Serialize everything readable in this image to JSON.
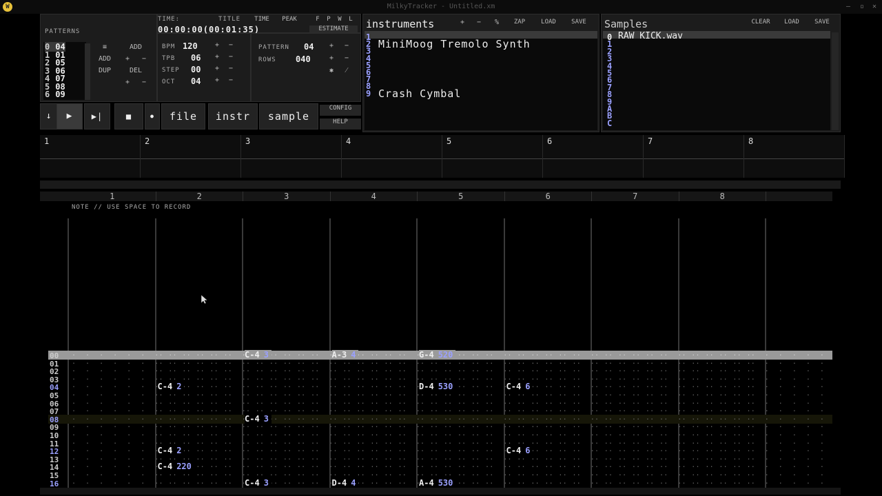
{
  "window": {
    "title": "MilkyTracker - Untitled.xm",
    "app_icon": "W",
    "min": "—",
    "max": "▫",
    "close": "✕"
  },
  "patterns_panel": {
    "title": "PATTERNS",
    "list": [
      {
        "idx": "0",
        "val": "04"
      },
      {
        "idx": "1",
        "val": "01"
      },
      {
        "idx": "2",
        "val": "05"
      },
      {
        "idx": "3",
        "val": "06"
      },
      {
        "idx": "4",
        "val": "07"
      },
      {
        "idx": "5",
        "val": "08"
      },
      {
        "idx": "6",
        "val": "09"
      }
    ],
    "menu_icon": "≡",
    "add": "ADD",
    "plus": "+",
    "minus": "−",
    "add2": "ADD",
    "dup": "DUP",
    "del": "DEL"
  },
  "song_params": {
    "bpm": {
      "label": "BPM",
      "value": "120"
    },
    "tpb": {
      "label": "TPB",
      "value": "06"
    },
    "step": {
      "label": "STEP",
      "value": "00"
    },
    "oct": {
      "label": "OCT",
      "value": "04"
    }
  },
  "time_panel": {
    "time_label": "TIME:",
    "time_value": "00:00:00(00:01:35)",
    "title_label": "TITLE",
    "time_btn": "TIME",
    "peak_btn": "PEAK",
    "flags": [
      "F",
      "P",
      "W",
      "L"
    ],
    "estimate": "ESTIMATE"
  },
  "pattern_params": {
    "pattern": {
      "label": "PATTERN",
      "value": "04"
    },
    "rows": {
      "label": "ROWS",
      "value": "040"
    },
    "star": "✱",
    "slash": "⁄"
  },
  "transport": {
    "down_icon": "↓",
    "play_icon": "▶",
    "play_pattern_icon": "▶|",
    "stop_icon": "■",
    "record_icon": "●",
    "file": "file",
    "instr": "instr",
    "sample": "sample",
    "config": "CONFIG",
    "help": "HELP"
  },
  "instruments": {
    "title": "instruments",
    "plus": "+",
    "minus": "−",
    "percent": "%",
    "zap": "ZAP",
    "load": "LOAD",
    "save": "SAVE",
    "numbers": [
      "1",
      "2",
      "3",
      "4",
      "5",
      "6",
      "7",
      "8",
      "9"
    ],
    "names": [
      "",
      "MiniMoog Tremolo Synth",
      "",
      "",
      "",
      "",
      "",
      "",
      "Crash Cymbal"
    ]
  },
  "samples": {
    "title": "Samples",
    "clear": "CLEAR",
    "load": "LOAD",
    "save": "SAVE",
    "numbers": [
      "0",
      "1",
      "2",
      "3",
      "4",
      "5",
      "6",
      "7",
      "8",
      "9",
      "A",
      "B",
      "C"
    ],
    "names": [
      "RAW KICK.wav"
    ]
  },
  "tracks": {
    "labels": [
      "1",
      "2",
      "3",
      "4",
      "5",
      "6",
      "7",
      "8"
    ]
  },
  "pattern_editor": {
    "channel_labels": [
      "1",
      "2",
      "3",
      "4",
      "5",
      "6",
      "7",
      "8"
    ],
    "hint": "NOTE // USE SPACE TO RECORD",
    "row_numbers": [
      "00",
      "01",
      "02",
      "03",
      "04",
      "05",
      "06",
      "07",
      "08",
      "09",
      "10",
      "11",
      "12",
      "13",
      "14",
      "15",
      "16"
    ],
    "notes": [
      {
        "row": 0,
        "ch": 3,
        "note": "C-4",
        "ins": "3"
      },
      {
        "row": 0,
        "ch": 4,
        "note": "A-3",
        "ins": "4"
      },
      {
        "row": 0,
        "ch": 5,
        "note": "G-4",
        "ins": "520"
      },
      {
        "row": 4,
        "ch": 2,
        "note": "C-4",
        "ins": "2"
      },
      {
        "row": 4,
        "ch": 5,
        "note": "D-4",
        "ins": "530"
      },
      {
        "row": 4,
        "ch": 6,
        "note": "C-4",
        "ins": "6"
      },
      {
        "row": 8,
        "ch": 3,
        "note": "C-4",
        "ins": "3"
      },
      {
        "row": 12,
        "ch": 2,
        "note": "C-4",
        "ins": "2"
      },
      {
        "row": 12,
        "ch": 6,
        "note": "C-4",
        "ins": "6"
      },
      {
        "row": 14,
        "ch": 2,
        "note": "C-4",
        "ins": "220"
      },
      {
        "row": 16,
        "ch": 3,
        "note": "C-4",
        "ins": "3"
      },
      {
        "row": 16,
        "ch": 4,
        "note": "D-4",
        "ins": "4"
      },
      {
        "row": 16,
        "ch": 5,
        "note": "A-4",
        "ins": "530"
      }
    ]
  },
  "colors": {
    "accent": "#9aa0ff",
    "cursor_row": "#9a9a9a"
  }
}
